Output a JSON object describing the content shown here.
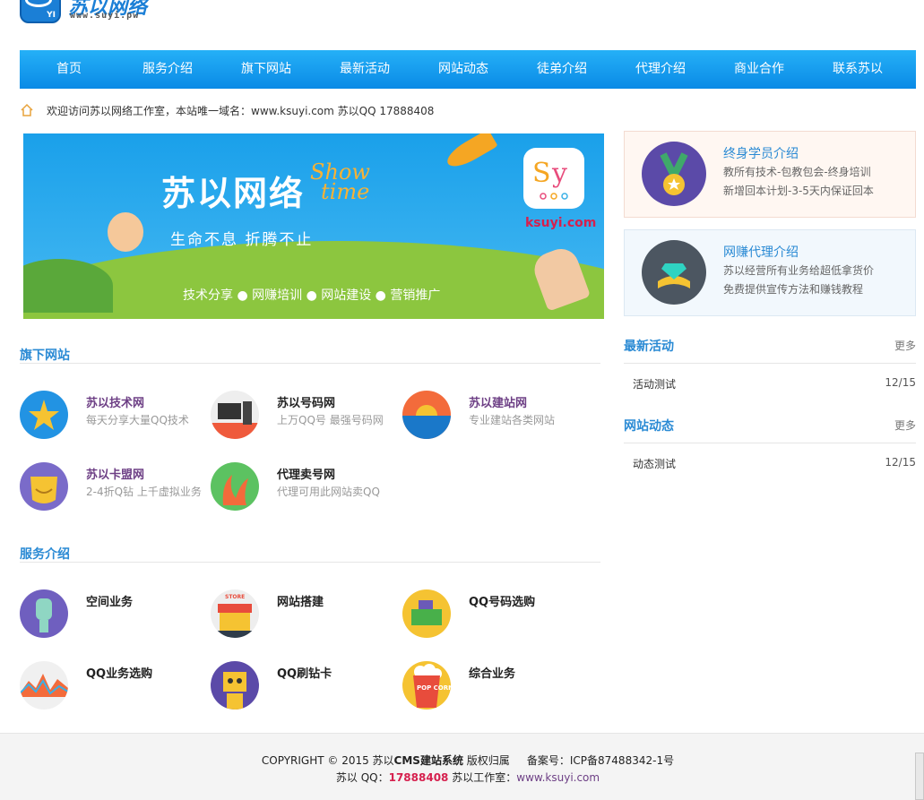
{
  "logo": {
    "title": "苏以网络",
    "url": "www.suyi.pw",
    "badge_text": "YI"
  },
  "nav": [
    "首页",
    "服务介绍",
    "旗下网站",
    "最新活动",
    "网站动态",
    "徒弟介绍",
    "代理介绍",
    "商业合作",
    "联系苏以"
  ],
  "breadcrumb": {
    "text": "欢迎访问苏以网络工作室，本站唯一域名：www.ksuyi.com 苏以QQ 17888408"
  },
  "banner": {
    "title": "苏以网络",
    "show": "Show",
    "time": "time",
    "slogan": "生命不息 折腾不止",
    "tags": "技术分享 ● 网赚培训 ● 网站建设 ● 营销推广",
    "app_text": "Sy",
    "site": "ksuyi.com"
  },
  "cards": [
    {
      "title": "终身学员介绍",
      "line1": "教所有技术-包教包会-终身培训",
      "line2": "新增回本计划-3-5天内保证回本"
    },
    {
      "title": "网赚代理介绍",
      "line1": "苏以经营所有业务给超低拿货价",
      "line2": "免费提供宣传方法和赚钱教程"
    }
  ],
  "sites": {
    "title": "旗下网站",
    "items": [
      {
        "name": "苏以技术网",
        "desc": "每天分享大量QQ技术"
      },
      {
        "name": "苏以号码网",
        "desc": "上万QQ号 最强号码网"
      },
      {
        "name": "苏以建站网",
        "desc": "专业建站各类网站"
      },
      {
        "name": "苏以卡盟网",
        "desc": "2-4折Q钻 上千虚拟业务"
      },
      {
        "name": "代理卖号网",
        "desc": "代理可用此网站卖QQ"
      }
    ]
  },
  "services": {
    "title": "服务介绍",
    "items": [
      {
        "name": "空间业务",
        "store": ""
      },
      {
        "name": "网站搭建",
        "store": "STORE"
      },
      {
        "name": "QQ号码选购",
        "store": ""
      },
      {
        "name": "QQ业务选购",
        "store": ""
      },
      {
        "name": "QQ刷钻卡",
        "store": ""
      },
      {
        "name": "综合业务",
        "store": "POP CORN"
      }
    ]
  },
  "activities": {
    "title": "最新活动",
    "more": "更多",
    "items": [
      {
        "title": "活动测试",
        "date": "12/15"
      }
    ]
  },
  "news": {
    "title": "网站动态",
    "more": "更多",
    "items": [
      {
        "title": "动态测试",
        "date": "12/15"
      }
    ]
  },
  "footer": {
    "copyright": "COPYRIGHT © 2015 苏以",
    "cms": "CMS建站系统",
    "rights": "版权归属",
    "icp": "备案号：ICP备87488342-1号",
    "qq_label": "苏以 QQ：",
    "qq": "17888408",
    "studio_label": "苏以工作室：",
    "studio_url": "www.ksuyi.com"
  }
}
